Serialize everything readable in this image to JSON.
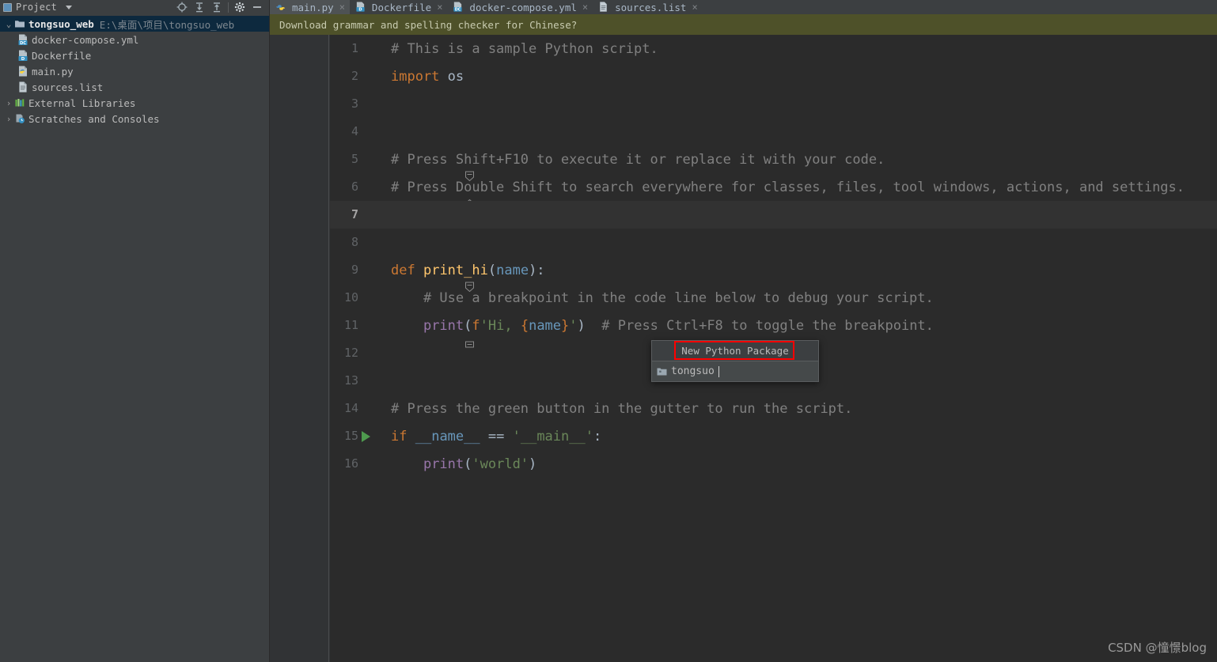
{
  "sidebar": {
    "panel_title": "Project",
    "panel_icon": "project-panel-icon",
    "tools": [
      {
        "name": "locate-target-icon",
        "label": "Select Opened File"
      },
      {
        "name": "expand-all-icon",
        "label": "Expand All"
      },
      {
        "name": "collapse-all-icon",
        "label": "Collapse All"
      },
      {
        "name": "gear-icon",
        "label": "Settings"
      },
      {
        "name": "minimize-icon",
        "label": "Hide"
      }
    ],
    "tree": [
      {
        "label": "tongsuo_web",
        "path": "E:\\桌面\\项目\\tongsuo_web",
        "icon": "folder-icon",
        "arrow": "⌄",
        "expanded": true,
        "selected": true,
        "depth": 0
      },
      {
        "label": "docker-compose.yml",
        "icon": "docker-compose-file-icon",
        "badge": "DC",
        "depth": 1
      },
      {
        "label": "Dockerfile",
        "icon": "dockerfile-icon",
        "badge": "D",
        "depth": 1
      },
      {
        "label": "main.py",
        "icon": "python-file-icon",
        "depth": 1
      },
      {
        "label": "sources.list",
        "icon": "text-file-icon",
        "depth": 1
      },
      {
        "label": "External Libraries",
        "icon": "external-libraries-icon",
        "arrow": "›",
        "depth": 0
      },
      {
        "label": "Scratches and Consoles",
        "icon": "scratches-icon",
        "arrow": "›",
        "depth": 0
      }
    ]
  },
  "tabs": [
    {
      "label": "main.py",
      "icon": "python-file-icon",
      "active": true,
      "close": "×"
    },
    {
      "label": "Dockerfile",
      "icon": "dockerfile-icon",
      "active": false,
      "close": "×"
    },
    {
      "label": "docker-compose.yml",
      "icon": "docker-compose-file-icon",
      "active": false,
      "close": "×"
    },
    {
      "label": "sources.list",
      "icon": "text-file-icon",
      "active": false,
      "close": "×"
    }
  ],
  "notification": {
    "message": "Download grammar and spelling checker for Chinese?"
  },
  "editor": {
    "current_line": 7,
    "lines": [
      {
        "n": 1,
        "text": "# This is a sample Python script."
      },
      {
        "n": 2,
        "text": "import os"
      },
      {
        "n": 3,
        "text": ""
      },
      {
        "n": 4,
        "text": ""
      },
      {
        "n": 5,
        "text": "# Press Shift+F10 to execute it or replace it with your code."
      },
      {
        "n": 6,
        "text": "# Press Double Shift to search everywhere for classes, files, tool windows, actions, and settings."
      },
      {
        "n": 7,
        "text": ""
      },
      {
        "n": 8,
        "text": ""
      },
      {
        "n": 9,
        "text": "def print_hi(name):"
      },
      {
        "n": 10,
        "text": "    # Use a breakpoint in the code line below to debug your script."
      },
      {
        "n": 11,
        "text": "    print(f'Hi, {name}')  # Press Ctrl+F8 to toggle the breakpoint."
      },
      {
        "n": 12,
        "text": ""
      },
      {
        "n": 13,
        "text": ""
      },
      {
        "n": 14,
        "text": "# Press the green button in the gutter to run the script."
      },
      {
        "n": 15,
        "text": "if __name__ == '__main__':"
      },
      {
        "n": 16,
        "text": "    print('world')"
      }
    ]
  },
  "popup": {
    "title": "New Python Package",
    "input_value": "tongsuo",
    "icon": "package-folder-icon",
    "highlight_color": "#ff0000"
  },
  "watermark": {
    "text": "CSDN @憧憬blog"
  },
  "colors": {
    "editor_bg": "#2b2b2b",
    "gutter_bg": "#313335",
    "panel_bg": "#3c3f41",
    "selection_bg": "#0d293e",
    "notification_bg": "#4e5129",
    "keyword": "#cc7832",
    "string": "#6a8759",
    "comment": "#808080",
    "function": "#ffc66d",
    "builtin": "#8888c6"
  }
}
